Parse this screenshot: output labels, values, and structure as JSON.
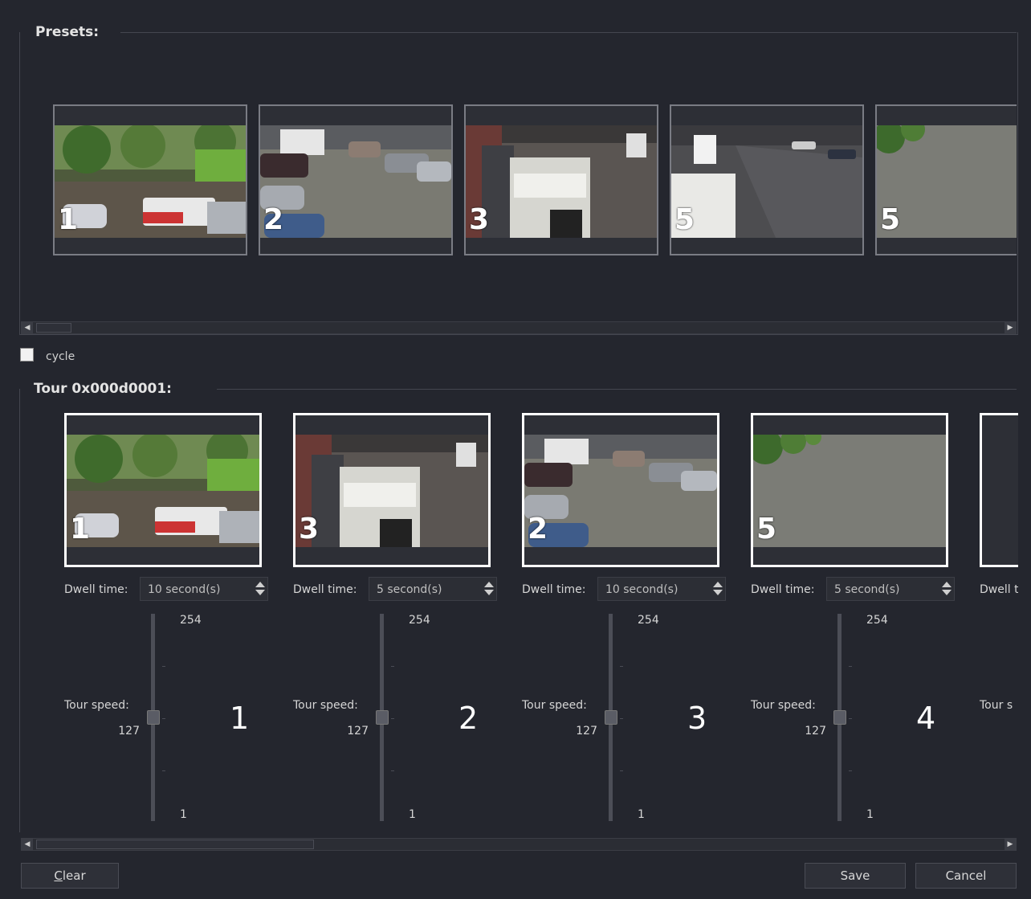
{
  "presets": {
    "title": "Presets:",
    "items": [
      {
        "number": "1"
      },
      {
        "number": "2"
      },
      {
        "number": "3"
      },
      {
        "number": "5"
      },
      {
        "number": ""
      }
    ]
  },
  "cycle": {
    "label": "cycle",
    "checked": false
  },
  "tour": {
    "title": "Tour 0x000d0001:",
    "dwell_label": "Dwell time:",
    "speed_label": "Tour speed:",
    "items": [
      {
        "step": "1",
        "preset": "1",
        "dwell": "10 second(s)",
        "speed": "127",
        "max": "254",
        "min": "1"
      },
      {
        "step": "2",
        "preset": "3",
        "dwell": "5 second(s)",
        "speed": "127",
        "max": "254",
        "min": "1"
      },
      {
        "step": "3",
        "preset": "2",
        "dwell": "10 second(s)",
        "speed": "127",
        "max": "254",
        "min": "1"
      },
      {
        "step": "4",
        "preset": "5",
        "dwell": "5 second(s)",
        "speed": "127",
        "max": "254",
        "min": "1"
      }
    ],
    "partial_dwell": "Dwell t",
    "partial_speed": "Tour s"
  },
  "buttons": {
    "clear_first": "C",
    "clear_rest": "lear",
    "save": "Save",
    "cancel": "Cancel"
  }
}
